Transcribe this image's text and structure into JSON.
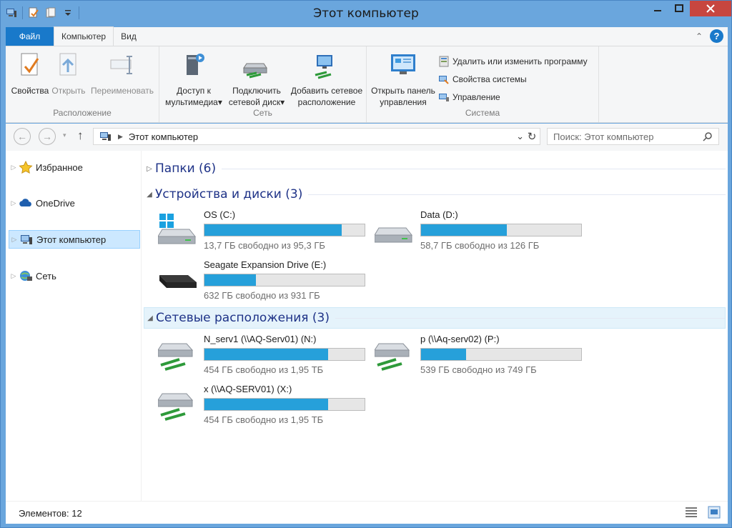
{
  "window": {
    "title": "Этот компьютер"
  },
  "ribbon_tabs": [
    {
      "label": "Файл"
    },
    {
      "label": "Компьютер"
    },
    {
      "label": "Вид"
    }
  ],
  "ribbon": {
    "location": {
      "label": "Расположение",
      "properties": "Свойства",
      "open": "Открыть",
      "rename": "Переименовать"
    },
    "network": {
      "label": "Сеть",
      "media_line1": "Доступ к",
      "media_line2": "мультимедиа",
      "map_line1": "Подключить",
      "map_line2": "сетевой диск",
      "add_line1": "Добавить сетевое",
      "add_line2": "расположение"
    },
    "system": {
      "label": "Система",
      "control_line1": "Открыть панель",
      "control_line2": "управления",
      "uninstall": "Удалить или изменить программу",
      "sysprops": "Свойства системы",
      "manage": "Управление"
    }
  },
  "address": {
    "path": "Этот компьютер",
    "search_placeholder": "Поиск: Этот компьютер"
  },
  "nav": [
    {
      "label": "Избранное",
      "icon": "star-icon"
    },
    {
      "label": "OneDrive",
      "icon": "cloud-icon"
    },
    {
      "label": "Этот компьютер",
      "icon": "computer-icon"
    },
    {
      "label": "Сеть",
      "icon": "network-icon"
    }
  ],
  "sections": {
    "folders": "Папки (6)",
    "devices": "Устройства и диски (3)",
    "network": "Сетевые расположения (3)"
  },
  "devices": [
    {
      "name": "OS (C:)",
      "free": "13,7 ГБ свободно из 95,3 ГБ",
      "used_fraction": 0.856,
      "icon": "windows-drive-icon"
    },
    {
      "name": "Data (D:)",
      "free": "58,7 ГБ свободно из 126 ГБ",
      "used_fraction": 0.534,
      "icon": "hard-drive-icon"
    },
    {
      "name": "Seagate Expansion Drive (E:)",
      "free": "632 ГБ свободно из 931 ГБ",
      "used_fraction": 0.321,
      "icon": "external-drive-icon"
    }
  ],
  "network_locations": [
    {
      "name": "N_serv1 (\\\\AQ-Serv01) (N:)",
      "free": "454 ГБ свободно из 1,95 ТБ",
      "used_fraction": 0.773
    },
    {
      "name": "p (\\\\Aq-serv02) (P:)",
      "free": "539 ГБ свободно из 749 ГБ",
      "used_fraction": 0.28
    },
    {
      "name": "x (\\\\AQ-SERV01) (X:)",
      "free": "454 ГБ свободно из 1,95 ТБ",
      "used_fraction": 0.773
    }
  ],
  "status": {
    "count": "Элементов: 12"
  },
  "colors": {
    "accent": "#1979ca",
    "bar_fill": "#26a0da",
    "section_title": "#1e3287"
  }
}
